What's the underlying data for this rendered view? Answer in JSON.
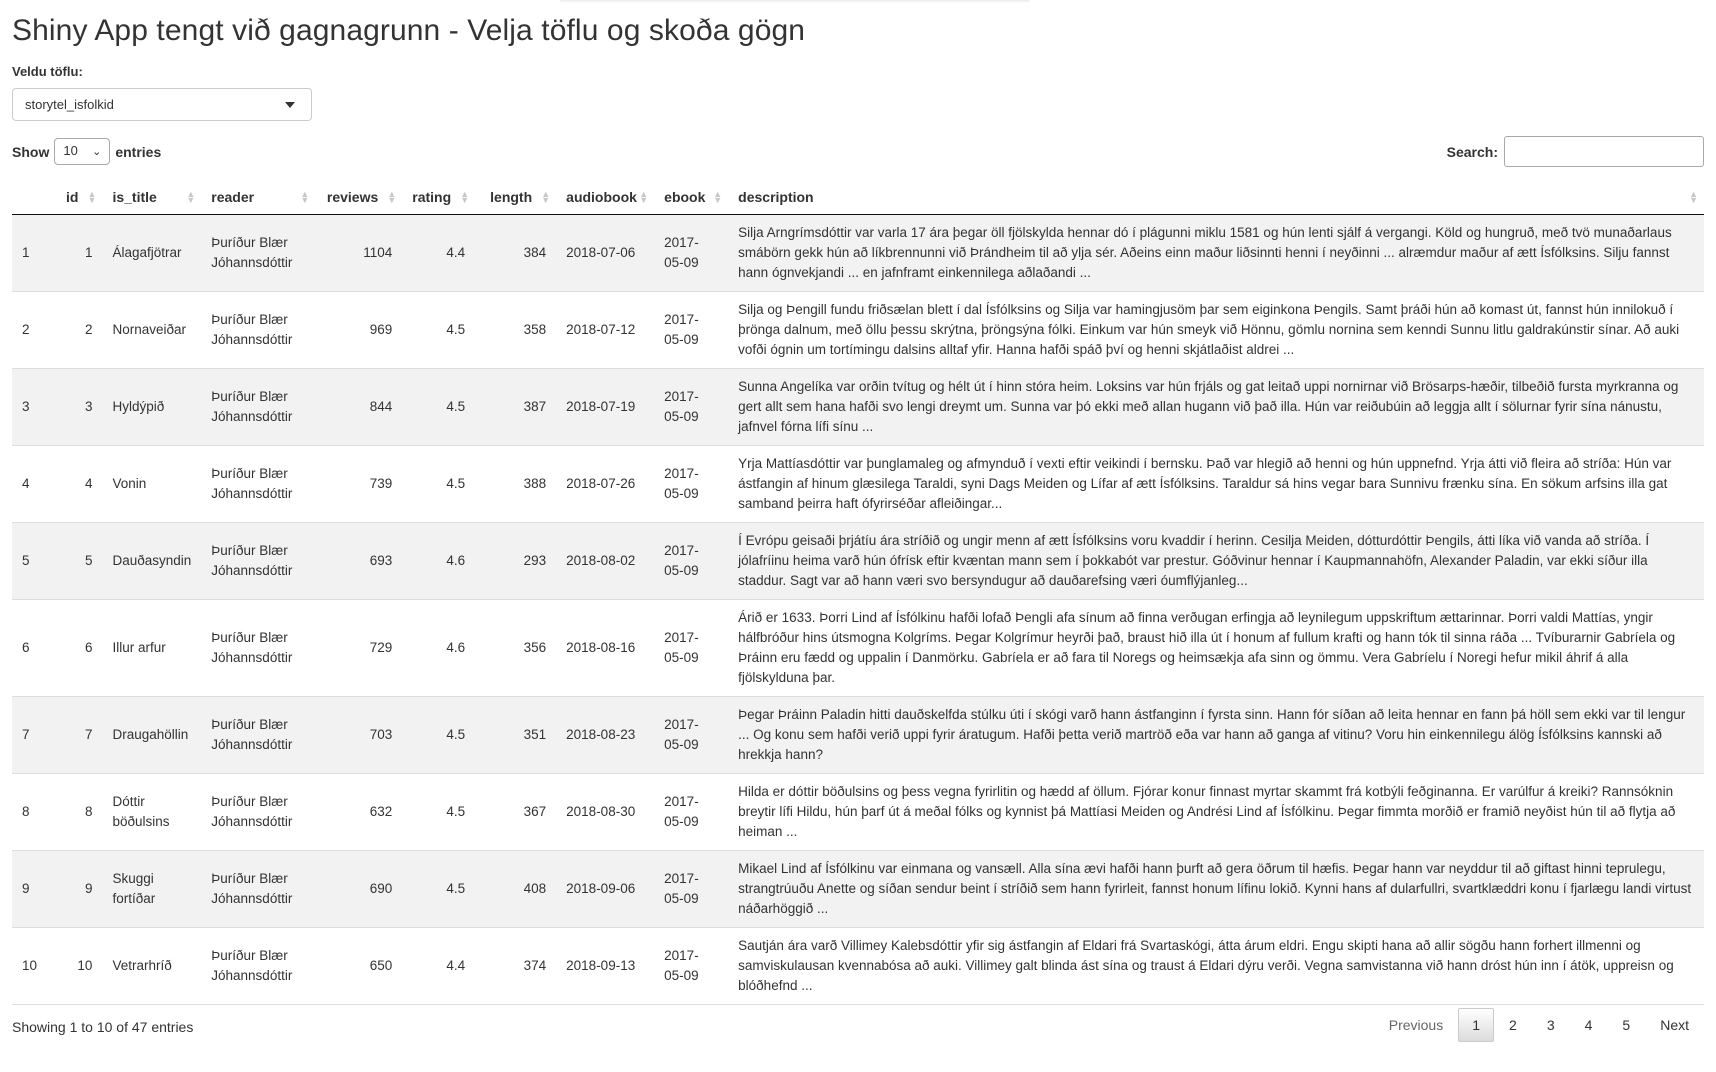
{
  "page_title": "Shiny App tengt við gagnagrunn - Velja töflu og skoða gögn",
  "table_select": {
    "label": "Veldu töflu:",
    "value": "storytel_isfolkid"
  },
  "length": {
    "show_label": "Show",
    "value": "10",
    "entries_label": "entries"
  },
  "search": {
    "label": "Search:",
    "value": ""
  },
  "columns": [
    "",
    "id",
    "is_title",
    "reader",
    "reviews",
    "rating",
    "length",
    "audiobook",
    "ebook",
    "description"
  ],
  "rows": [
    {
      "row": "1",
      "id": "1",
      "title": "Álagafjötrar",
      "reader": "Þuríður Blær Jóhannsdóttir",
      "reviews": "1104",
      "rating": "4.4",
      "length": "384",
      "audiobook": "2018-07-06",
      "ebook": "2017-05-09",
      "description": "Silja Arngrímsdóttir var varla 17 ára þegar öll fjölskylda hennar dó í plágunni miklu 1581 og hún lenti sjálf á vergangi. Köld og hungruð, með tvö munaðarlaus smábörn gekk hún að líkbrennunni við Þrándheim til að ylja sér. Aðeins einn maður liðsinnti henni í neyðinni ... alræmdur maður af ætt Ísfólksins. Silju fannst hann ógnvekjandi ... en jafnframt einkennilega aðlaðandi ..."
    },
    {
      "row": "2",
      "id": "2",
      "title": "Nornaveiðar",
      "reader": "Þuríður Blær Jóhannsdóttir",
      "reviews": "969",
      "rating": "4.5",
      "length": "358",
      "audiobook": "2018-07-12",
      "ebook": "2017-05-09",
      "description": "Silja og Þengill fundu friðsælan blett í dal Ísfólksins og Silja var hamingjusöm þar sem eiginkona Þengils. Samt þráði hún að komast út, fannst hún innilokuð í þrönga dalnum, með öllu þessu skrýtna, þröngsýna fólki. Einkum var hún smeyk við Hönnu, gömlu nornina sem kenndi Sunnu litlu galdrakúnstir sínar. Að auki vofði ógnin um tortímingu dalsins alltaf yfir. Hanna hafði spáð því og henni skjátlaðist aldrei ..."
    },
    {
      "row": "3",
      "id": "3",
      "title": "Hyldýpið",
      "reader": "Þuríður Blær Jóhannsdóttir",
      "reviews": "844",
      "rating": "4.5",
      "length": "387",
      "audiobook": "2018-07-19",
      "ebook": "2017-05-09",
      "description": "Sunna Angelíka var orðin tvítug og hélt út í hinn stóra heim. Loksins var hún frjáls og gat leitað uppi nornirnar við Brösarps-hæðir, tilbeðið fursta myrkranna og gert allt sem hana hafði svo lengi dreymt um. Sunna var þó ekki með allan hugann við það illa. Hún var reiðubúin að leggja allt í sölurnar fyrir sína nánustu, jafnvel fórna lífi sínu ..."
    },
    {
      "row": "4",
      "id": "4",
      "title": "Vonin",
      "reader": "Þuríður Blær Jóhannsdóttir",
      "reviews": "739",
      "rating": "4.5",
      "length": "388",
      "audiobook": "2018-07-26",
      "ebook": "2017-05-09",
      "description": "Yrja Mattíasdóttir var þunglamaleg og afmynduð í vexti eftir veikindi í bernsku. Það var hlegið að henni og hún uppnefnd. Yrja átti við fleira að stríða: Hún var ástfangin af hinum glæsilega Taraldi, syni Dags Meiden og Lífar af ætt Ísfólksins. Taraldur sá hins vegar bara Sunnivu frænku sína. En sökum arfsins illa gat samband þeirra haft ófyrirséðar afleiðingar..."
    },
    {
      "row": "5",
      "id": "5",
      "title": "Dauðasyndin",
      "reader": "Þuríður Blær Jóhannsdóttir",
      "reviews": "693",
      "rating": "4.6",
      "length": "293",
      "audiobook": "2018-08-02",
      "ebook": "2017-05-09",
      "description": "Í Evrópu geisaði þrjátíu ára stríðið og ungir menn af ætt Ísfólksins voru kvaddir í herinn. Cesilja Meiden, dótturdóttir Þengils, átti líka við vanda að stríða. Í jólafríinu heima varð hún ófrísk eftir kvæntan mann sem í þokkabót var prestur. Góðvinur hennar í Kaupmannahöfn, Alexander Paladin, var ekki síður illa staddur. Sagt var að hann væri svo bersyndugur að dauðarefsing væri óumflýjanleg..."
    },
    {
      "row": "6",
      "id": "6",
      "title": "Illur arfur",
      "reader": "Þuríður Blær Jóhannsdóttir",
      "reviews": "729",
      "rating": "4.6",
      "length": "356",
      "audiobook": "2018-08-16",
      "ebook": "2017-05-09",
      "description": "Árið er 1633. Þorri Lind af Ísfólkinu hafði lofað Þengli afa sínum að finna verðugan erfingja að leynilegum uppskriftum ættarinnar. Þorri valdi Mattías, yngir hálfbróður hins útsmogna Kolgríms. Þegar Kolgrímur heyrði það, braust hið illa út í honum af fullum krafti og hann tók til sinna ráða ... Tvíburarnir Gabríela og Þráinn eru fædd og uppalin í Danmörku. Gabríela er að fara til Noregs og heimsækja afa sinn og ömmu. Vera Gabríelu í Noregi hefur mikil áhrif á alla fjölskylduna þar."
    },
    {
      "row": "7",
      "id": "7",
      "title": "Draugahöllin",
      "reader": "Þuríður Blær Jóhannsdóttir",
      "reviews": "703",
      "rating": "4.5",
      "length": "351",
      "audiobook": "2018-08-23",
      "ebook": "2017-05-09",
      "description": "Þegar Þráinn Paladin hitti dauðskelfda stúlku úti í skógi varð hann ástfanginn í fyrsta sinn. Hann fór síðan að leita hennar en fann þá höll sem ekki var til lengur ... Og konu sem hafði verið uppi fyrir áratugum. Hafði þetta verið martröð eða var hann að ganga af vitinu? Voru hin einkennilegu álög Ísfólksins kannski að hrekkja hann?"
    },
    {
      "row": "8",
      "id": "8",
      "title": "Dóttir böðulsins",
      "reader": "Þuríður Blær Jóhannsdóttir",
      "reviews": "632",
      "rating": "4.5",
      "length": "367",
      "audiobook": "2018-08-30",
      "ebook": "2017-05-09",
      "description": "Hilda er dóttir böðulsins og þess vegna fyrirlitin og hædd af öllum. Fjórar konur finnast myrtar skammt frá kotbýli feðginanna. Er varúlfur á kreiki? Rannsóknin breytir lífi Hildu, hún þarf út á meðal fólks og kynnist þá Mattíasi Meiden og Andrési Lind af Ísfólkinu. Þegar fimmta morðið er framið neyðist hún til að flytja að heiman ..."
    },
    {
      "row": "9",
      "id": "9",
      "title": "Skuggi fortíðar",
      "reader": "Þuríður Blær Jóhannsdóttir",
      "reviews": "690",
      "rating": "4.5",
      "length": "408",
      "audiobook": "2018-09-06",
      "ebook": "2017-05-09",
      "description": "Mikael Lind af Ísfólkinu var einmana og vansæll. Alla sína ævi hafði hann þurft að gera öðrum til hæfis. Þegar hann var neyddur til að giftast hinni teprulegu, strangtrúuðu Anette og síðan sendur beint í stríðið sem hann fyrirleit, fannst honum lífinu lokið. Kynni hans af dularfullri, svartklæddri konu í fjarlægu landi virtust náðarhöggið ..."
    },
    {
      "row": "10",
      "id": "10",
      "title": "Vetrarhríð",
      "reader": "Þuríður Blær Jóhannsdóttir",
      "reviews": "650",
      "rating": "4.4",
      "length": "374",
      "audiobook": "2018-09-13",
      "ebook": "2017-05-09",
      "description": "Sautján ára varð Villimey Kalebsdóttir yfir sig ástfangin af Eldari frá Svartaskógi, átta árum eldri. Engu skipti hana að allir sögðu hann forhert illmenni og samviskulausan kvennabósa að auki. Villimey galt blinda ást sína og traust á Eldari dýru verði. Vegna samvistanna við hann dróst hún inn í átök, uppreisn og blóðhefnd ..."
    }
  ],
  "info_text": "Showing 1 to 10 of 47 entries",
  "pagination": {
    "previous": "Previous",
    "pages": [
      "1",
      "2",
      "3",
      "4",
      "5"
    ],
    "next": "Next",
    "current": "1"
  }
}
